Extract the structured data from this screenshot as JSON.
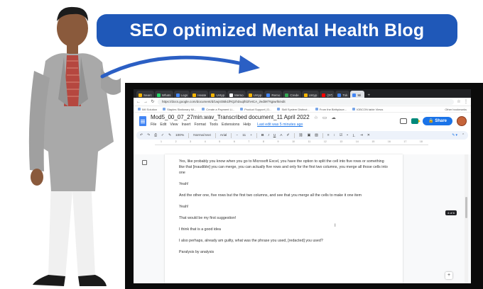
{
  "banner": {
    "text": "SEO optimized Mental Health Blog"
  },
  "browser": {
    "tabs": [
      {
        "label": "Searc",
        "active": false
      },
      {
        "label": "Whats",
        "active": false
      },
      {
        "label": "Logs",
        "active": false
      },
      {
        "label": "Heate",
        "active": false
      },
      {
        "label": "Untyp",
        "active": false
      },
      {
        "label": "Memo",
        "active": false
      },
      {
        "label": "Untyp",
        "active": false
      },
      {
        "label": "Remo",
        "active": false
      },
      {
        "label": "Crede",
        "active": false
      },
      {
        "label": "Untyp",
        "active": false
      },
      {
        "label": "(37)",
        "active": false
      },
      {
        "label": "Tok",
        "active": false
      },
      {
        "label": "Mi",
        "active": true
      }
    ],
    "new_tab": "+",
    "url": "https://docs.google.com/document/d/1wj4OBk1fRQzhDuqlhl2hHCA_i/edit#/?tgiwrlk/edit",
    "bookmarks": [
      "IMI Solution",
      "Staples Stationary Mi...",
      "Create a Payment Li...",
      "Product Support | D...",
      "Skill System Distinct...",
      "From the Birthplace...",
      "IOBCON table Views"
    ],
    "bookmarks_right": "Other bookmarks"
  },
  "doc": {
    "title": "Mod5_00_07_27min.wav_Transcribed document_11 April 2022",
    "menu": [
      "File",
      "Edit",
      "View",
      "Insert",
      "Format",
      "Tools",
      "Extensions",
      "Help"
    ],
    "last_edit": "Last edit was 5 minutes ago",
    "share_label": "Share",
    "toolbar": {
      "zoom": "100%",
      "style": "Normal text",
      "font": "Arial",
      "size": "11"
    },
    "ruler_ticks": [
      "1",
      "2",
      "3",
      "4",
      "5",
      "6",
      "7",
      "8",
      "9",
      "10",
      "11",
      "12",
      "13",
      "14",
      "15",
      "16",
      "17",
      "18"
    ],
    "paragraphs": [
      "Yes, like probably you know when you go to Microsoft Excel, you have the option to split the cell into five rows or something like that [inaudible] you can merge, you can actually five rows and only for the first two columns, you merge all those cells into one",
      "Yeah!",
      "And the other one, five rows but the first two columns, and see that you merge all the cells to make it one item",
      "Yeah!",
      "That would be my first suggestion!",
      "I think that is a good idea",
      "I also perhaps, already am guilty, what was the phrase you used, [redacted] you used?",
      "Paralysis by analysis"
    ],
    "page_badge": "4 of 6"
  },
  "colors": {
    "banner": "#1f58b8",
    "share": "#1a73e8",
    "docs_blue": "#4285f4"
  }
}
